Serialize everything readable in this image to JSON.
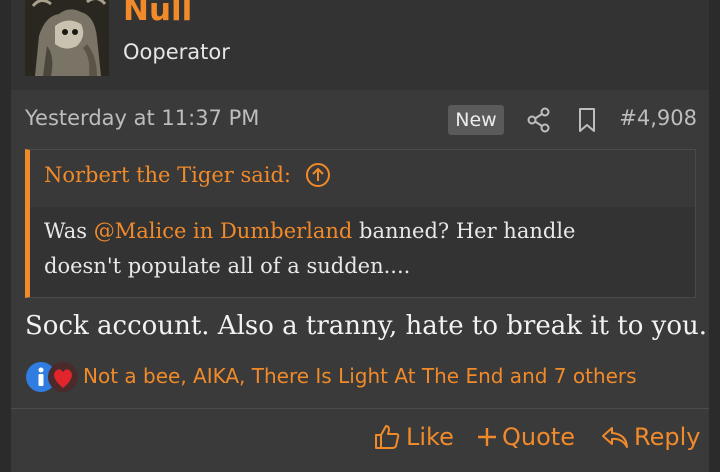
{
  "user": {
    "name": "Null",
    "title": "Ooperator"
  },
  "meta": {
    "date": "Yesterday at 11:37 PM",
    "badge": "New",
    "post_number": "#4,908"
  },
  "quote": {
    "author": "Norbert the Tiger said:",
    "body_prefix": "Was ",
    "mention": "@Malice in Dumberland",
    "body_suffix": " banned? Her handle doesn't populate all of a sudden...."
  },
  "post": {
    "text": "Sock account. Also a tranny, hate to break it to you."
  },
  "reactions": {
    "icons": [
      "informative-icon",
      "heart-icon"
    ],
    "names": "Not a bee, AIKA, There Is Light At The End and 7 others"
  },
  "actions": {
    "like": "Like",
    "quote": "Quote",
    "reply": "Reply"
  },
  "colors": {
    "accent": "#f08a2a",
    "background": "#3a3a3a",
    "header_bg": "#333333"
  }
}
